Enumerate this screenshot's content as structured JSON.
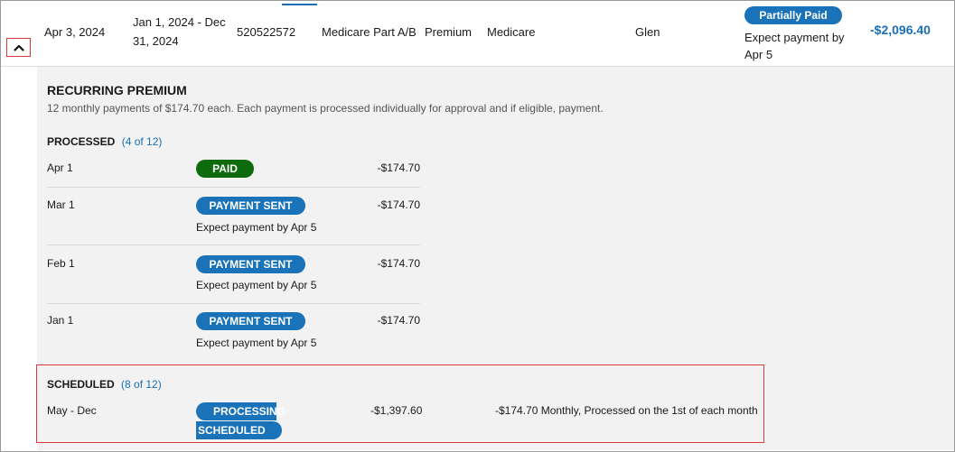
{
  "claim": {
    "date": "Apr 3, 2024",
    "period": "Jan 1, 2024 - Dec 31, 2024",
    "id": "520522572",
    "plan": "Medicare Part A/B",
    "type": "Premium",
    "payer": "Medicare",
    "member": "Glen",
    "status_label": "Partially Paid",
    "status_note": "Expect payment by Apr 5",
    "amount": "-$2,096.40",
    "toggle_icon": "chevron-up-icon"
  },
  "detail": {
    "title": "RECURRING PREMIUM",
    "description": "12 monthly payments of $174.70 each. Each payment is processed individually for approval and if eligible, payment.",
    "processed": {
      "title": "PROCESSED",
      "count": "(4 of 12)",
      "payments": [
        {
          "date": "Apr 1",
          "status": "PAID",
          "status_color": "#0d6a0d",
          "note": "",
          "amount": "-$174.70"
        },
        {
          "date": "Mar 1",
          "status": "PAYMENT SENT",
          "status_color": "#1a73b8",
          "note": "Expect payment by Apr 5",
          "amount": "-$174.70"
        },
        {
          "date": "Feb 1",
          "status": "PAYMENT SENT",
          "status_color": "#1a73b8",
          "note": "Expect payment by Apr 5",
          "amount": "-$174.70"
        },
        {
          "date": "Jan 1",
          "status": "PAYMENT SENT",
          "status_color": "#1a73b8",
          "note": "Expect payment by Apr 5",
          "amount": "-$174.70"
        }
      ]
    },
    "scheduled": {
      "title": "SCHEDULED",
      "count": "(8 of 12)",
      "date": "May - Dec",
      "status_line1": "PROCESSING",
      "status_line2": "SCHEDULED",
      "amount": "-$1,397.60",
      "frequency": "-$174.70 Monthly, Processed on the 1st of each month"
    }
  },
  "colors": {
    "accent": "#1a73b8",
    "paid": "#0d6a0d",
    "highlight": "#d93a3a"
  }
}
